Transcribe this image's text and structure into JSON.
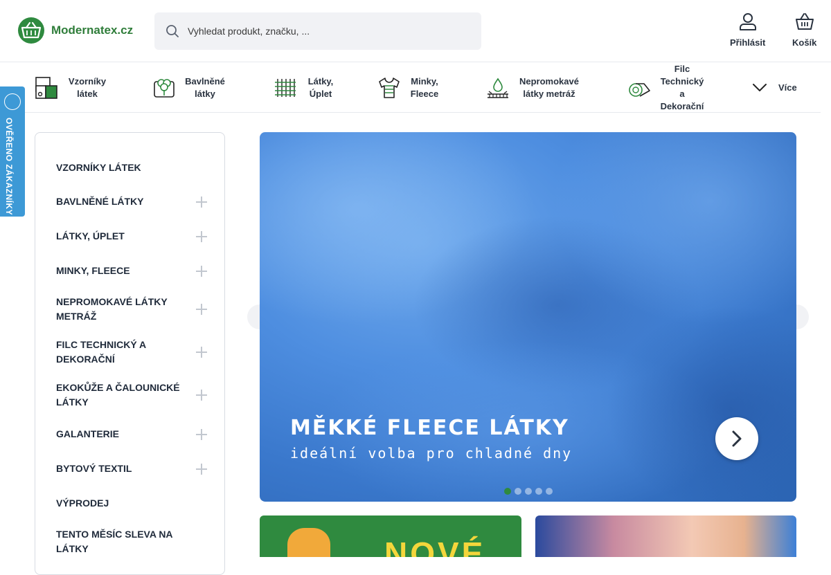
{
  "header": {
    "logo_text": "Modernatex.cz",
    "search_placeholder": "Vyhledat produkt, značku, ...",
    "login_label": "Přihlásit",
    "cart_label": "Košík"
  },
  "catnav": {
    "items": [
      {
        "label": "Vzorníky látek",
        "icon": "swatch-icon"
      },
      {
        "label": "Bavlněné látky",
        "icon": "cotton-icon"
      },
      {
        "label": "Látky, Úplet",
        "icon": "knit-icon"
      },
      {
        "label": "Minky, Fleece",
        "icon": "sweater-icon"
      },
      {
        "label": "Nepromokavé látky metráž",
        "icon": "waterproof-icon"
      },
      {
        "label": "Filc Technický a Dekorační",
        "icon": "felt-roll-icon"
      }
    ],
    "more_label": "Více"
  },
  "badge": {
    "text": "OVĚŘENO ZÁKAZNÍKY"
  },
  "sidebar": {
    "items": [
      {
        "label": "VZORNÍKY LÁTEK",
        "expandable": false
      },
      {
        "label": "BAVLNĚNÉ LÁTKY",
        "expandable": true
      },
      {
        "label": "LÁTKY, ÚPLET",
        "expandable": true
      },
      {
        "label": "MINKY, FLEECE",
        "expandable": true
      },
      {
        "label": "NEPROMOKAVÉ LÁTKY METRÁŽ",
        "expandable": true
      },
      {
        "label": "FILC TECHNICKÝ A DEKORAČNÍ",
        "expandable": true
      },
      {
        "label": "EKOKŮŽE A ČALOUNICKÉ LÁTKY",
        "expandable": true
      },
      {
        "label": "GALANTERIE",
        "expandable": true
      },
      {
        "label": "BYTOVÝ TEXTIL",
        "expandable": true
      },
      {
        "label": "VÝPRODEJ",
        "expandable": false
      },
      {
        "label": "TENTO MĚSÍC SLEVA NA LÁTKY",
        "expandable": false
      }
    ]
  },
  "hero": {
    "title": "MĚKKÉ FLEECE LÁTKY",
    "subtitle": "ideální volba pro chladné dny",
    "slide_count": 5,
    "active_slide": 1
  },
  "banners": {
    "left_text": "NOVÉ"
  },
  "colors": {
    "brand_green": "#2f8a3f",
    "badge_blue": "#3d99d6",
    "fleece_blue": "#4e8ee0"
  }
}
